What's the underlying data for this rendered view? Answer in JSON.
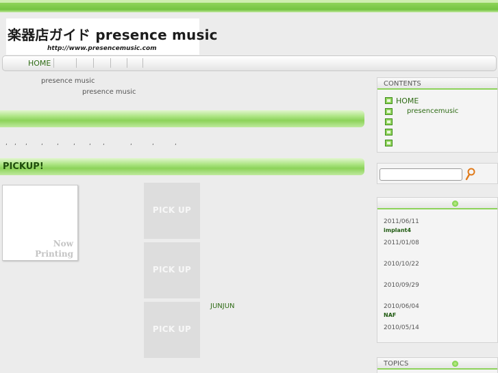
{
  "header": {
    "logo_title": "楽器店ガイド presence music",
    "logo_url": "http://www.presencemusic.com"
  },
  "nav": {
    "home": "HOME"
  },
  "intro": {
    "line1": "presence music",
    "line2": "presence music"
  },
  "main": {
    "commas": [
      ",",
      ",",
      ",",
      ",",
      ",",
      ",",
      ",",
      ",",
      ",",
      ","
    ],
    "pickup_heading": "PICKUP!",
    "now_printing": [
      "Now",
      "Printing"
    ],
    "pickup_badges": [
      "PICK UP",
      "PICK UP",
      "PICK UP"
    ],
    "junjun": "JUNJUN"
  },
  "sidebar": {
    "contents_heading": "CONTENTS",
    "contents_items": [
      "HOME",
      "presencemusic"
    ],
    "news": [
      {
        "date": "2011/06/11",
        "title": "implant4"
      },
      {
        "date": "2011/01/08",
        "title": ""
      },
      {
        "date": "2010/10/22",
        "title": ""
      },
      {
        "date": "2010/09/29",
        "title": ""
      },
      {
        "date": "2010/06/04",
        "title": "NAF"
      },
      {
        "date": "2010/05/14",
        "title": ""
      }
    ],
    "topics_heading": "TOPICS"
  },
  "colors": {
    "accent_green": "#8cd359",
    "link_green": "#2e6b14",
    "background": "#ececec"
  }
}
